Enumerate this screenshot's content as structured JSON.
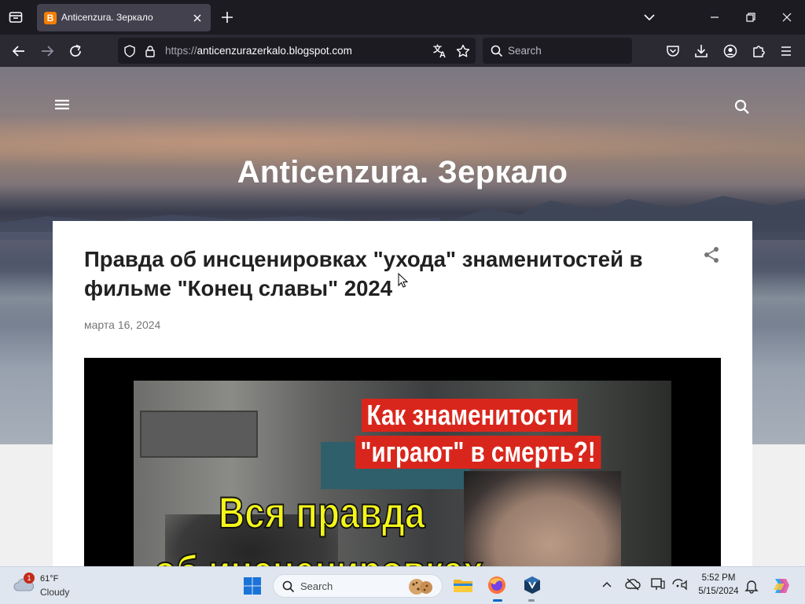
{
  "browser": {
    "tab_title": "Anticenzura. Зеркало",
    "tab_favicon": "B",
    "url_scheme": "https://",
    "url_host": "anticenzurazerkalo.blogspot.com",
    "search_placeholder": "Search",
    "accent_color": "#f57d00"
  },
  "blog": {
    "title": "Anticenzura. Зеркало",
    "post": {
      "title": "Правда об инсценировках \"ухода\" знаменитостей в фильме \"Конец славы\" 2024",
      "date": "марта 16, 2024",
      "image_captions": {
        "red_line1": "Как знаменитости",
        "red_line2": "\"играют\" в смерть?!",
        "yellow_line1": "Вся правда",
        "yellow_line2": "об инсценировках"
      }
    }
  },
  "taskbar": {
    "weather_temp": "61°F",
    "weather_desc": "Cloudy",
    "weather_badge": "1",
    "search_placeholder": "Search",
    "time": "5:52 PM",
    "date": "5/15/2024"
  }
}
